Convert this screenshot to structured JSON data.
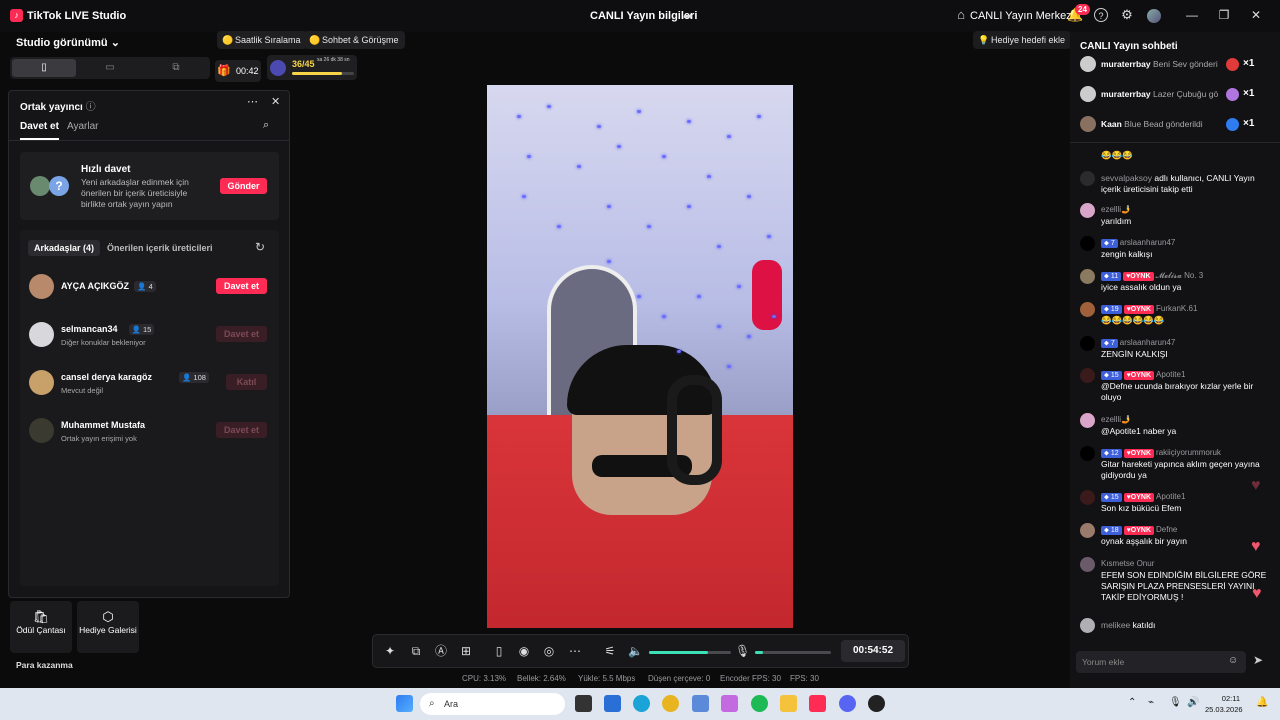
{
  "titlebar": {
    "app_title": "TikTok LIVE Studio",
    "center_title": "CANLI Yayın bilgileri",
    "live_center": "CANLI Yayın Merkezi",
    "notif_count": "24"
  },
  "studio": {
    "view_label": "Studio görünümü",
    "view_options": [
      "portrait",
      "landscape",
      "split"
    ]
  },
  "top_pills": {
    "ranking": "Saatlik Sıralama",
    "chat_meet": "Sohbet & Görüşme",
    "timer": "00:42",
    "goal_progress": "36/45",
    "goal_time": "sa 26 dk 38 sn",
    "goal_fraction": 0.8,
    "gift_goal": "Hediye hedefi ekle"
  },
  "cohost": {
    "title": "Ortak yayıncı",
    "tabs": [
      "Davet et",
      "Ayarlar"
    ],
    "quick_invite": {
      "title": "Hızlı davet",
      "desc": "Yeni arkadaşlar edinmek için önerilen bir içerik üreticisiyle birlikte ortak yayın yapın",
      "button": "Gönder"
    },
    "friend_tabs": [
      "Arkadaşlar (4)",
      "Önerilen içerik üreticileri"
    ],
    "friends": [
      {
        "name": "AYÇA AÇIKGÖZ",
        "count": "4",
        "sub": "",
        "button": "Davet et",
        "enabled": true,
        "color": "#b8896a"
      },
      {
        "name": "selmancan34",
        "count": "15",
        "sub": "Diğer konuklar bekleniyor",
        "button": "Davet et",
        "enabled": false,
        "color": "#d8d8dc"
      },
      {
        "name": "cansel derya karagöz",
        "count": "108",
        "sub": "Mevcut değil",
        "button": "Katıl",
        "enabled": false,
        "color": "#c8a06a"
      },
      {
        "name": "Muhammet Mustafa",
        "count": "",
        "sub": "Ortak yayın erişimi yok",
        "button": "Davet et",
        "enabled": false,
        "color": "#3a3a30"
      }
    ]
  },
  "bottom_tools": {
    "reward_bag": "Ödül Çantası",
    "gift_gallery": "Hediye Galerisi",
    "earn": "Para kazanma"
  },
  "controls": {
    "volume_level": 0.72,
    "mic_level": 0.1,
    "elapsed": "00:54:52"
  },
  "stats": {
    "cpu": "CPU: 3.13%",
    "memory": "Bellek: 2.64%",
    "upload": "Yükle: 5.5 Mbps",
    "dropped": "Düşen çerçeve: 0",
    "encoder_fps": "Encoder FPS: 30",
    "fps": "FPS: 30"
  },
  "chat": {
    "title": "CANLI Yayın sohbeti",
    "gifts": [
      {
        "user": "muraterrbay",
        "text": "Beni Sev gönderi",
        "mult": "×1",
        "color": "#ccc",
        "icon": "#e03a3a"
      },
      {
        "user": "muraterrbay",
        "text": "Lazer Çubuğu gö",
        "mult": "×1",
        "color": "#ccc",
        "icon": "#b076e0"
      },
      {
        "user": "Kaan",
        "text": "Blue Bead gönderildi",
        "mult": "×1",
        "color": "#8a7060",
        "icon": "#2f7bf0"
      }
    ],
    "messages": [
      {
        "head": "",
        "body": "😂😂😂",
        "color": "#333"
      },
      {
        "head": "sevvalpaksoy",
        "body": "adlı kullanıcı, CANLI Yayın içerik üreticisini takip etti",
        "color": "#2b2b2e"
      },
      {
        "head": "ezellli🤳",
        "body": "yarıldım",
        "color": "#d9a6c9"
      },
      {
        "head": "arslaanharun47",
        "badge": "7",
        "body": "zengin kalkışı",
        "color": "#000"
      },
      {
        "head": "𝓜𝓮𝓵𝓲𝓼𝓪 No. 3",
        "badge": "11",
        "oynk": "OYNK",
        "body": "iyice assalık oldun ya",
        "color": "#8a7a60"
      },
      {
        "head": "FurkanK.61",
        "badge": "19",
        "oynk": "OYNK",
        "body": "😂😂😂😂😂😂",
        "color": "#a0603a"
      },
      {
        "head": "arslaanharun47",
        "badge": "7",
        "body": "ZENGİN KALKIŞI",
        "color": "#000"
      },
      {
        "head": "Apotite1",
        "badge": "15",
        "oynk": "OYNK",
        "body": "@Defne ucunda bırakıyor kızlar yerle bir oluyo",
        "color": "#3a1a1a"
      },
      {
        "head": "ezellli🤳",
        "body": "@Apotite1 naber ya",
        "color": "#d9a6c9"
      },
      {
        "head": "rakiiçiyorummoruk",
        "badge": "12",
        "oynk": "OYNK",
        "body": "Gitar hareketi yapınca aklım geçen yayına gidiyordu ya",
        "color": "#000"
      },
      {
        "head": "Apotite1",
        "badge": "15",
        "oynk": "OYNK",
        "body": "Son kız bükücü Efem",
        "color": "#3a1a1a"
      },
      {
        "head": "Defne",
        "badge": "18",
        "oynk": "OYNK",
        "body": "oynak aşşalık bir yayın",
        "color": "#9a7a6a"
      },
      {
        "head": "Kısmetse Onur",
        "body": "EFEM SON EDİNDİĞİM BİLGİLERE GÖRE SARIŞIN PLAZA PRENSESLERİ YAYINI TAKİP EDİYORMUŞ !",
        "color": "#6a5a6a"
      },
      {
        "head": "melikee",
        "body": "katıldı",
        "color": "#b0b0b4"
      }
    ],
    "input_placeholder": "Yorum ekle"
  },
  "taskbar": {
    "search": "Ara",
    "time": "02:11",
    "date": "25.03.2026"
  }
}
